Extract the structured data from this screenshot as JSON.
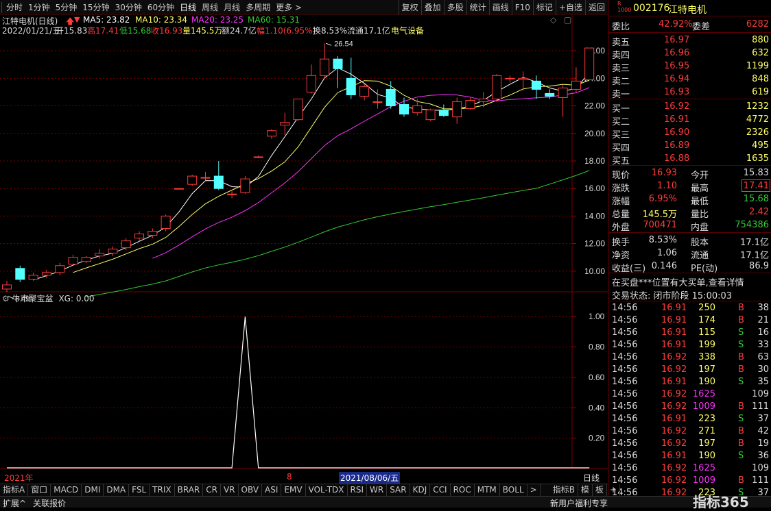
{
  "toolbar": {
    "periods": [
      "分时",
      "1分钟",
      "5分钟",
      "15分钟",
      "30分钟",
      "60分钟",
      "日线",
      "周线",
      "月线",
      "多周期",
      "更多 >"
    ],
    "active_period": "日线",
    "actions": [
      "复权",
      "叠加",
      "多股",
      "统计",
      "画线",
      "F10",
      "标记",
      "+自选",
      "返回"
    ]
  },
  "chart_header": {
    "title": "江特电机(日线)",
    "ma5": "MA5: 23.82",
    "ma10": "MA10: 23.34",
    "ma20": "MA20: 23.25",
    "ma60": "MA60: 15.31",
    "date": "2022/01/21/五",
    "open": "开15.83",
    "high": "高17.41",
    "low": "低15.68",
    "close": "收16.93",
    "volume": "量145.5万",
    "amount": "额24.7亿",
    "change": "幅1.10(6.95%)",
    "turnover": "换8.53%",
    "float": "流通17.1亿",
    "sector": "电气设备"
  },
  "indicator_header": {
    "name": "牛市聚宝盆",
    "value": "XG: 0.00"
  },
  "chart_data": [
    {
      "type": "candlestick",
      "y_ticks": [
        "26.00",
        "24.00",
        "22.00",
        "20.00",
        "18.00",
        "16.00",
        "14.00",
        "12.00",
        "10.00"
      ],
      "ylim": [
        8.4,
        27.2
      ],
      "annotations": {
        "high": "26.54",
        "low": "8.49"
      },
      "candles": [
        [
          8.7,
          9.0,
          8.49,
          9.3
        ],
        [
          10.2,
          9.4,
          9.2,
          10.4
        ],
        [
          9.4,
          9.7,
          9.3,
          9.9
        ],
        [
          9.7,
          9.9,
          9.5,
          10.1
        ],
        [
          9.9,
          10.4,
          9.7,
          10.6
        ],
        [
          10.5,
          11.0,
          10.4,
          11.2
        ],
        [
          10.7,
          11.0,
          10.6,
          11.1
        ],
        [
          11.1,
          11.3,
          10.9,
          11.6
        ],
        [
          11.3,
          11.6,
          11.1,
          11.8
        ],
        [
          11.7,
          12.2,
          11.5,
          12.4
        ],
        [
          12.4,
          12.7,
          12.2,
          12.9
        ],
        [
          12.6,
          12.9,
          12.4,
          13.1
        ],
        [
          13.1,
          14.0,
          12.9,
          14.1
        ],
        [
          16.0,
          16.0,
          16.0,
          16.0
        ],
        [
          16.3,
          16.9,
          16.2,
          17.0
        ],
        [
          16.8,
          16.8,
          16.6,
          17.2
        ],
        [
          16.9,
          16.0,
          15.9,
          18.0
        ],
        [
          15.6,
          15.6,
          15.3,
          15.8
        ],
        [
          15.7,
          16.7,
          15.6,
          16.9
        ],
        [
          18.3,
          18.3,
          18.2,
          18.4
        ],
        [
          19.8,
          20.2,
          19.6,
          20.3
        ],
        [
          20.6,
          20.8,
          19.9,
          21.5
        ],
        [
          21.0,
          22.5,
          20.9,
          22.5
        ],
        [
          23.0,
          24.2,
          22.9,
          25.0
        ],
        [
          24.2,
          25.4,
          24.0,
          26.54
        ],
        [
          25.4,
          24.7,
          23.3,
          25.6
        ],
        [
          24.0,
          22.8,
          22.5,
          25.5
        ],
        [
          22.7,
          23.4,
          22.4,
          23.6
        ],
        [
          22.3,
          22.3,
          21.8,
          23.2
        ],
        [
          23.2,
          22.0,
          21.8,
          23.8
        ],
        [
          22.1,
          21.4,
          21.2,
          22.6
        ],
        [
          21.5,
          22.0,
          21.3,
          22.5
        ],
        [
          21.0,
          21.7,
          20.9,
          21.8
        ],
        [
          21.7,
          21.3,
          21.2,
          22.1
        ],
        [
          21.2,
          22.3,
          20.7,
          22.6
        ],
        [
          21.8,
          22.4,
          21.7,
          22.6
        ],
        [
          22.3,
          22.5,
          21.9,
          23.0
        ],
        [
          22.5,
          24.2,
          22.3,
          24.3
        ],
        [
          24.0,
          24.0,
          23.7,
          24.2
        ],
        [
          23.9,
          24.0,
          23.1,
          24.5
        ],
        [
          23.8,
          23.2,
          22.5,
          24.2
        ],
        [
          22.9,
          22.7,
          22.5,
          23.2
        ],
        [
          22.6,
          23.3,
          21.2,
          23.5
        ],
        [
          23.2,
          23.8,
          23.0,
          24.8
        ],
        [
          23.9,
          26.2,
          23.9,
          26.2
        ]
      ]
    },
    {
      "type": "line",
      "name": "XG",
      "y_ticks": [
        "1.00",
        "0.80",
        "0.60",
        "0.40",
        "0.20"
      ],
      "ylim": [
        0,
        1.1
      ],
      "values": [
        0,
        0,
        0,
        0,
        0,
        0,
        0,
        0,
        0,
        0,
        0,
        0,
        0,
        0,
        0,
        0,
        0,
        0,
        1,
        0,
        0,
        0,
        0,
        0,
        0,
        0,
        0,
        0,
        0,
        0,
        0,
        0,
        0,
        0,
        0,
        0,
        0,
        0,
        0,
        0,
        0,
        0,
        0,
        0,
        0
      ]
    }
  ],
  "x_axis": {
    "year_label": "2021年",
    "month_label": "8",
    "cursor_date": "2021/08/06/五",
    "period": "日线"
  },
  "quote_panel": {
    "code": "002176",
    "name": "江特电机",
    "weibi_label": "委比",
    "weibi_value": "42.92%",
    "weicha_label": "委差",
    "weicha_value": "6282",
    "sells": [
      {
        "label": "卖五",
        "price": "16.97",
        "vol": "880"
      },
      {
        "label": "卖四",
        "price": "16.96",
        "vol": "632"
      },
      {
        "label": "卖三",
        "price": "16.95",
        "vol": "1199"
      },
      {
        "label": "卖二",
        "price": "16.94",
        "vol": "848"
      },
      {
        "label": "卖一",
        "price": "16.93",
        "vol": "619"
      }
    ],
    "buys": [
      {
        "label": "买一",
        "price": "16.92",
        "vol": "1232"
      },
      {
        "label": "买二",
        "price": "16.91",
        "vol": "4772"
      },
      {
        "label": "买三",
        "price": "16.90",
        "vol": "2326"
      },
      {
        "label": "买四",
        "price": "16.89",
        "vol": "495"
      },
      {
        "label": "买五",
        "price": "16.88",
        "vol": "1635"
      }
    ],
    "stats": [
      {
        "l1": "现价",
        "v1": "16.93",
        "l2": "今开",
        "v2": "15.83"
      },
      {
        "l1": "涨跌",
        "v1": "1.10",
        "l2": "最高",
        "v2": "17.41"
      },
      {
        "l1": "涨幅",
        "v1": "6.95%",
        "l2": "最低",
        "v2": "15.68"
      },
      {
        "l1": "总量",
        "v1": "145.5万",
        "l2": "量比",
        "v2": "2.42"
      },
      {
        "l1": "外盘",
        "v1": "700471",
        "l2": "内盘",
        "v2": "754386"
      },
      {
        "l1": "换手",
        "v1": "8.53%",
        "l2": "股本",
        "v2": "17.1亿"
      },
      {
        "l1": "净资",
        "v1": "1.06",
        "l2": "流通",
        "v2": "17.1亿"
      },
      {
        "l1": "收益(三)",
        "v1": "0.146",
        "l2": "PE(动)",
        "v2": "86.9"
      }
    ],
    "notice": "在买盘***位置有大买单,查看详情",
    "trade_status": "交易状态: 闭市阶段 15:00:03",
    "ticks": [
      {
        "t": "14:56",
        "p": "16.91",
        "v": "250",
        "d": "B",
        "n": "38"
      },
      {
        "t": "14:56",
        "p": "16.91",
        "v": "174",
        "d": "B",
        "n": "21"
      },
      {
        "t": "14:56",
        "p": "16.91",
        "v": "115",
        "d": "S",
        "n": "16"
      },
      {
        "t": "14:56",
        "p": "16.91",
        "v": "199",
        "d": "S",
        "n": "33"
      },
      {
        "t": "14:56",
        "p": "16.92",
        "v": "338",
        "d": "B",
        "n": "63"
      },
      {
        "t": "14:56",
        "p": "16.92",
        "v": "197",
        "d": "B",
        "n": "30"
      },
      {
        "t": "14:56",
        "p": "16.91",
        "v": "190",
        "d": "S",
        "n": "35"
      },
      {
        "t": "14:56",
        "p": "16.92",
        "v": "1625",
        "d": "",
        "n": "109"
      },
      {
        "t": "14:56",
        "p": "16.92",
        "v": "1009",
        "d": "B",
        "n": "111"
      },
      {
        "t": "14:56",
        "p": "16.91",
        "v": "223",
        "d": "S",
        "n": "37"
      },
      {
        "t": "14:56",
        "p": "16.92",
        "v": "271",
        "d": "B",
        "n": "42"
      },
      {
        "t": "14:56",
        "p": "16.92",
        "v": "197",
        "d": "B",
        "n": "19"
      },
      {
        "t": "14:56",
        "p": "16.91",
        "v": "190",
        "d": "S",
        "n": "36"
      },
      {
        "t": "14:56",
        "p": "16.92",
        "v": "1625",
        "d": "",
        "n": "109"
      },
      {
        "t": "14:56",
        "p": "16.92",
        "v": "1009",
        "d": "B",
        "n": "111"
      },
      {
        "t": "14:56",
        "p": "16.92",
        "v": "223",
        "d": "S",
        "n": "37"
      }
    ]
  },
  "bottom_tabs": [
    "指标A",
    "窗口",
    "MACD",
    "DMI",
    "DMA",
    "FSL",
    "TRIX",
    "BRAR",
    "CR",
    "VR",
    "OBV",
    "ASI",
    "EMV",
    "VOL-TDX",
    "RSI",
    "WR",
    "SAR",
    "KDJ",
    "CCI",
    "ROC",
    "MTM",
    "BOLL",
    ">",
    "指标B",
    "模",
    "板",
    "+"
  ],
  "status_bar": {
    "left1": "扩展^",
    "left2": "关联报价",
    "right1": "新用户福利专享",
    "brand": "指标365"
  },
  "colors": {
    "up": "#ff3c3c",
    "down": "#54ffff",
    "ma5": "#ffffff",
    "ma10": "#ffff66",
    "ma20": "#ff33ff",
    "ma60": "#33cc33",
    "grid": "#7a0000"
  }
}
